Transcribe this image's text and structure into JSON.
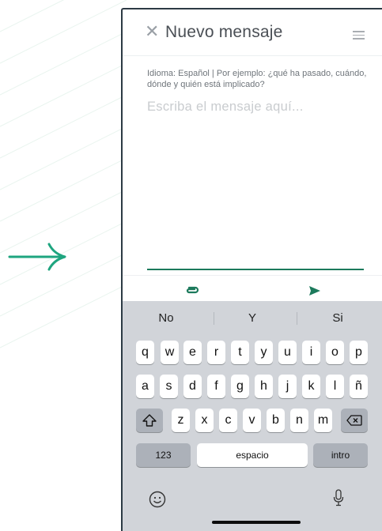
{
  "colors": {
    "accent": "#1c7a5c",
    "arrow": "#1ea57f"
  },
  "header": {
    "title": "Nuevo mensaje",
    "close_icon": "close-icon",
    "menu_icon": "hamburger-icon"
  },
  "composer": {
    "hint": "Idioma: Español | Por ejemplo: ¿qué ha pasado, cuándo, dónde y quién está implicado?",
    "placeholder": "Escriba el mensaje aquí..."
  },
  "actions": {
    "attach_icon": "paperclip-icon",
    "send_icon": "send-icon"
  },
  "keyboard": {
    "suggestions": [
      "No",
      "Y",
      "Si"
    ],
    "row1": [
      "q",
      "w",
      "e",
      "r",
      "t",
      "y",
      "u",
      "i",
      "o",
      "p"
    ],
    "row2": [
      "a",
      "s",
      "d",
      "f",
      "g",
      "h",
      "j",
      "k",
      "l",
      "ñ"
    ],
    "row3": [
      "z",
      "x",
      "c",
      "v",
      "b",
      "n",
      "m"
    ],
    "numbers_label": "123",
    "space_label": "espacio",
    "return_label": "intro"
  }
}
